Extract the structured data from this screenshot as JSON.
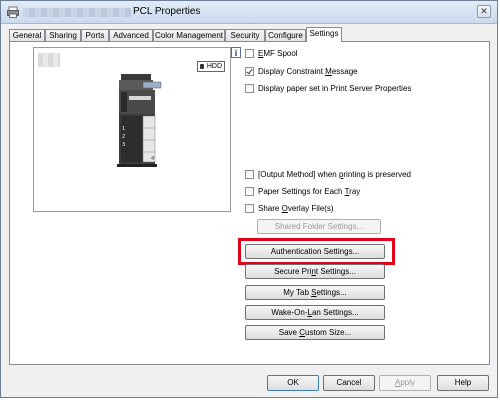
{
  "window": {
    "title": "PCL Properties",
    "close_glyph": "✕"
  },
  "tabs": [
    {
      "label": "General"
    },
    {
      "label": "Sharing"
    },
    {
      "label": "Ports"
    },
    {
      "label": "Advanced"
    },
    {
      "label": "Color Management"
    },
    {
      "label": "Security"
    },
    {
      "label": "Configure"
    },
    {
      "label": "Settings",
      "active": true
    }
  ],
  "preview": {
    "hdd_label": "HDD"
  },
  "info_icon": "i",
  "checkboxes": {
    "emf_spool": {
      "label_pre": "",
      "label_u": "E",
      "label_post": "MF Spool",
      "checked": false
    },
    "display_constraint": {
      "label_pre": "Display Constraint ",
      "label_u": "M",
      "label_post": "essage",
      "checked": true
    },
    "display_paper_set": {
      "label_pre": "Display paper set in Print Server Properties",
      "label_u": "",
      "label_post": "",
      "checked": false
    },
    "output_method": {
      "label_pre": "[Output Method] when ",
      "label_u": "p",
      "label_post": "rinting is preserved",
      "checked": false
    },
    "paper_settings_tray": {
      "label_pre": "Paper Settings for Each ",
      "label_u": "T",
      "label_post": "ray",
      "checked": false
    },
    "share_overlay": {
      "label_pre": "Share ",
      "label_u": "O",
      "label_post": "verlay File(s)",
      "checked": false
    }
  },
  "buttons": {
    "shared_folder": {
      "label": "Shared Folder Settings...",
      "disabled": true
    },
    "authentication": {
      "label": "Authentication Settings..."
    },
    "secure_print_pre": "Secure Pri",
    "secure_print_u": "n",
    "secure_print_post": "t Settings...",
    "my_tab_pre": "My Tab ",
    "my_tab_u": "S",
    "my_tab_post": "ettings...",
    "wake_pre": "Wake-On-",
    "wake_u": "L",
    "wake_post": "an Settings...",
    "save_pre": "Save ",
    "save_u": "C",
    "save_post": "ustom Size..."
  },
  "footer": {
    "ok": "OK",
    "cancel": "Cancel",
    "apply_u": "A",
    "apply_post": "pply",
    "help": "Help"
  },
  "colors": {
    "highlight": "#e3001b"
  }
}
